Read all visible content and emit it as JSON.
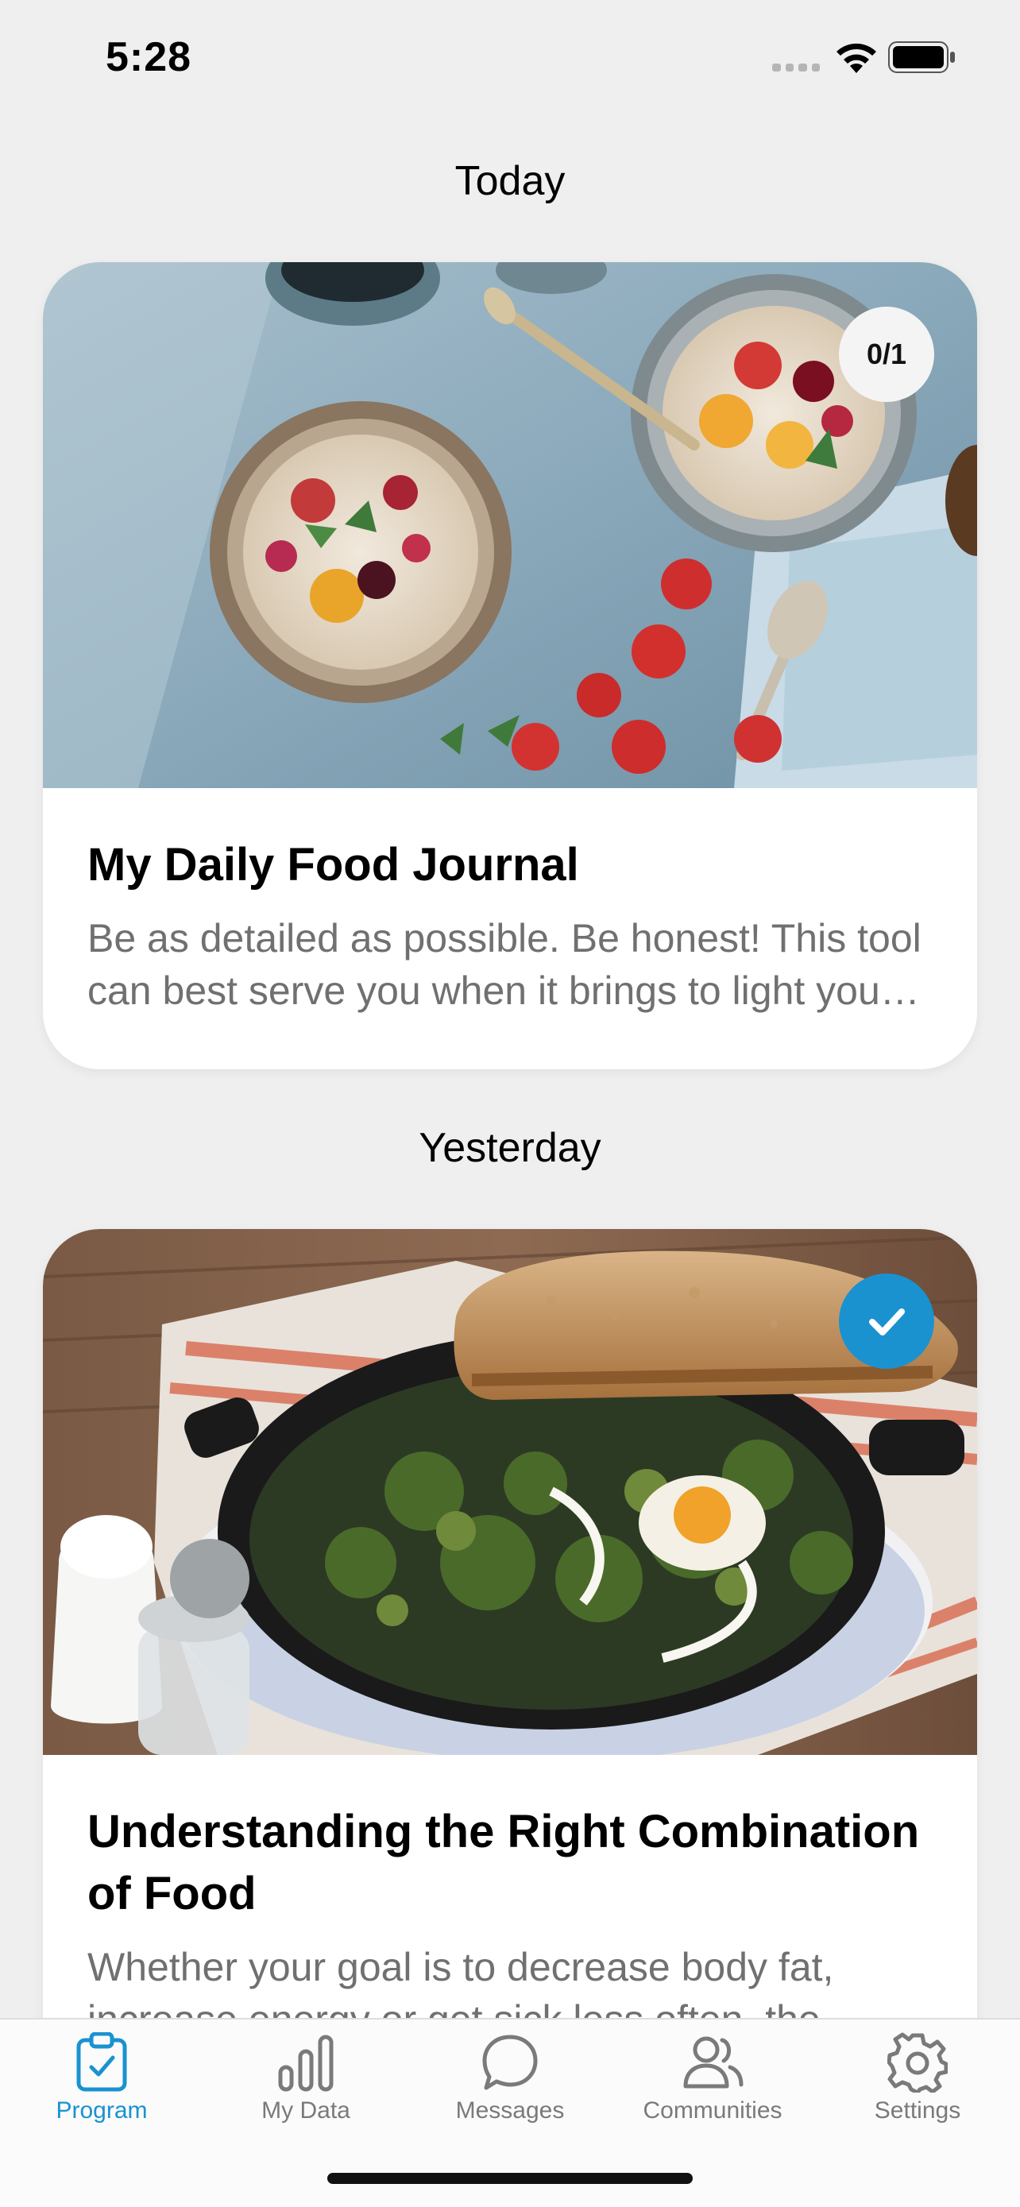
{
  "status_bar": {
    "time": "5:28"
  },
  "sections": [
    {
      "header": "Today",
      "card": {
        "title": "My Daily Food Journal",
        "description": "Be as detailed as possible. Be honest! This tool can best serve you when it brings to light your habits and patterns.",
        "badge": "0/1",
        "badge_state": "in-progress",
        "image": "bowls-of-oatmeal-with-fruit"
      }
    },
    {
      "header": "Yesterday",
      "card": {
        "title": "Understanding the Right Combination of Food",
        "description": "Whether your goal is to decrease body fat, increase energy or get sick less often, the",
        "badge": "",
        "badge_state": "completed",
        "image": "skillet-with-greens-egg-and-toast"
      }
    }
  ],
  "tab_bar": {
    "tabs": [
      {
        "label": "Program",
        "icon": "clipboard-check-icon",
        "active": true
      },
      {
        "label": "My Data",
        "icon": "bar-chart-icon",
        "active": false
      },
      {
        "label": "Messages",
        "icon": "chat-bubble-icon",
        "active": false
      },
      {
        "label": "Communities",
        "icon": "people-icon",
        "active": false
      },
      {
        "label": "Settings",
        "icon": "gear-icon",
        "active": false
      }
    ]
  },
  "colors": {
    "accent": "#1a92d0",
    "background": "#efefef"
  }
}
